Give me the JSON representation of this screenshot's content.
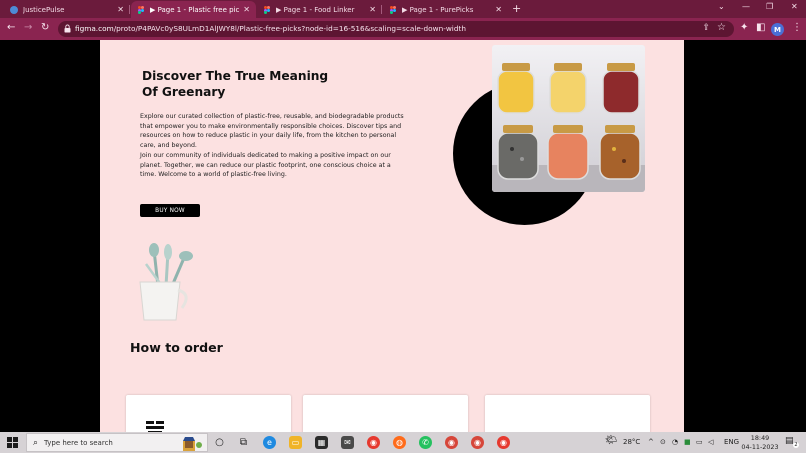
{
  "browser": {
    "tabs": [
      {
        "title": "JusticePulse",
        "active": false,
        "color": "#4d8bd6"
      },
      {
        "title": "▶ Page 1 - Plastic free picks",
        "active": true,
        "color": "#a259ff"
      },
      {
        "title": "▶ Page 1 - Food Linker",
        "active": false,
        "color": "#a259ff"
      },
      {
        "title": "▶ Page 1 - PurePicks",
        "active": false,
        "color": "#a259ff"
      }
    ],
    "url_host": "figma.com",
    "url_path": "/proto/P4PAVc0yS8ULmD1AlJWY8l/Plastic-free-picks?node-id=16-516&scaling=scale-down-width",
    "profile_initial": "M",
    "theme_color": "#8a2450"
  },
  "page": {
    "hero_title_line1": "Discover The True Meaning",
    "hero_title_line2": "Of Greenary",
    "hero_paragraph_1": "Explore our curated collection of plastic-free, reusable, and biodegradable products that empower you to make environmentally responsible choices. Discover tips and resources on how to reduce plastic in your daily life, from the kitchen to personal care, and beyond.",
    "hero_paragraph_2": "Join our community of individuals dedicated to making a positive impact on our planet. Together, we can reduce our plastic footprint, one conscious choice at a time. Welcome to a world of plastic-free living.",
    "buy_button": "BUY NOW",
    "section_title": "How to order",
    "background_color": "#fce1e1"
  },
  "taskbar": {
    "search_placeholder": "Type here to search",
    "weather": "28°C",
    "language": "ENG",
    "time": "18:49",
    "date": "04-11-2023",
    "notification_count": "2"
  }
}
